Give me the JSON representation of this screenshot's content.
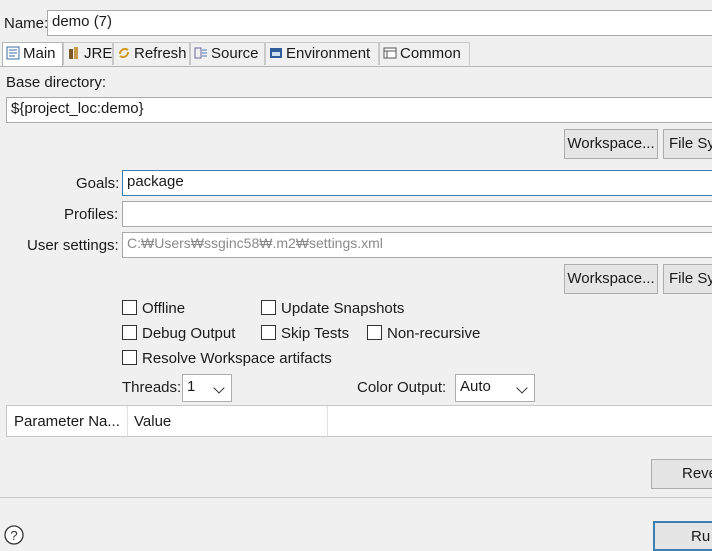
{
  "name": {
    "label": "Name:",
    "value": "demo (7)"
  },
  "tabs": [
    {
      "label": "Main",
      "icon": "main-tab-icon",
      "active": true
    },
    {
      "label": "JRE",
      "icon": "jre-icon"
    },
    {
      "label": "Refresh",
      "icon": "refresh-icon"
    },
    {
      "label": "Source",
      "icon": "source-icon"
    },
    {
      "label": "Environment",
      "icon": "environment-icon"
    },
    {
      "label": "Common",
      "icon": "common-icon"
    }
  ],
  "base_directory": {
    "label": "Base directory:",
    "value": "${project_loc:demo}",
    "workspace_button": "Workspace...",
    "filesystem_button": "File Sy"
  },
  "goals": {
    "label": "Goals:",
    "value": "package"
  },
  "profiles": {
    "label": "Profiles:",
    "value": ""
  },
  "user_settings": {
    "label": "User settings:",
    "value": "C:₩Users₩ssginc58₩.m2₩settings.xml",
    "workspace_button": "Workspace...",
    "filesystem_button": "File Sy"
  },
  "options": {
    "offline": "Offline",
    "update_snapshots": "Update Snapshots",
    "debug_output": "Debug Output",
    "skip_tests": "Skip Tests",
    "non_recursive": "Non-recursive",
    "resolve_workspace": "Resolve Workspace artifacts"
  },
  "threads": {
    "label": "Threads:",
    "value": "1"
  },
  "color_output": {
    "label": "Color Output:",
    "value": "Auto"
  },
  "parameters_table": {
    "columns": [
      "Parameter Na...",
      "Value"
    ]
  },
  "footer": {
    "revert_button": "Reve",
    "run_button": "Ru"
  }
}
